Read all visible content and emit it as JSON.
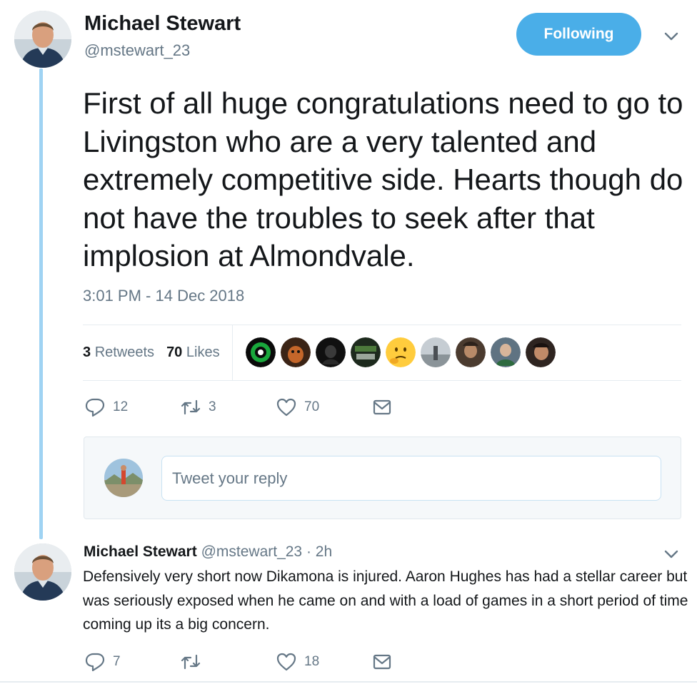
{
  "tweet": {
    "author_name": "Michael Stewart",
    "author_handle": "@mstewart_23",
    "follow_label": "Following",
    "text": "First of all huge congratulations need to go to Livingston who are a very talented and extremely competitive side. Hearts though do not have the troubles to seek after that implosion at Almondvale.",
    "timestamp": "3:01 PM - 14 Dec 2018",
    "retweets_count": "3",
    "retweets_label": "Retweets",
    "likes_count": "70",
    "likes_label": "Likes",
    "actions": {
      "replies": "12",
      "retweets": "3",
      "likes": "70"
    }
  },
  "reply_box": {
    "placeholder": "Tweet your reply"
  },
  "reply": {
    "author_name": "Michael Stewart",
    "author_handle": "@mstewart_23",
    "time": "· 2h",
    "text": "Defensively very short now Dikamona is injured. Aaron Hughes has had a stellar career but was seriously exposed when he came on and with a load of games in a short period of time coming up its a big concern.",
    "actions": {
      "replies": "7",
      "retweets": "",
      "likes": "18"
    }
  },
  "colors": {
    "accent": "#4aaee8",
    "thread_line": "#9fd3f3",
    "muted": "#657786",
    "text": "#14171a"
  },
  "icons": [
    "reply-icon",
    "retweet-icon",
    "heart-icon",
    "mail-icon",
    "chevron-down-icon"
  ]
}
